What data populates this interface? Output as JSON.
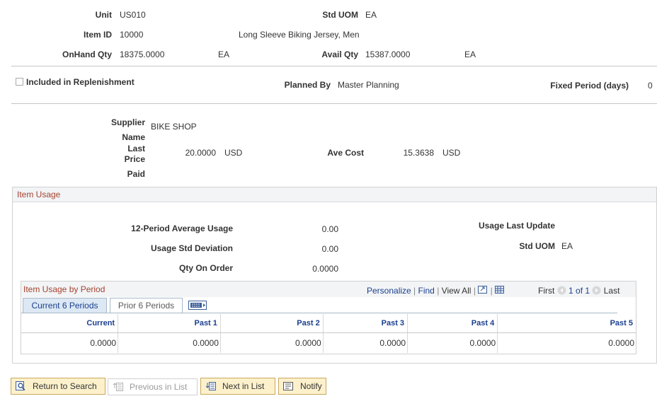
{
  "header": {
    "unit_label": "Unit",
    "unit_value": "US010",
    "std_uom_label": "Std UOM",
    "std_uom_value": "EA",
    "item_id_label": "Item ID",
    "item_id_value": "10000",
    "item_desc": "Long Sleeve Biking Jersey, Men",
    "onhand_label": "OnHand Qty",
    "onhand_value": "18375.0000",
    "onhand_uom": "EA",
    "avail_label": "Avail Qty",
    "avail_value": "15387.0000",
    "avail_uom": "EA"
  },
  "replenishment": {
    "included_label": "Included in Replenishment",
    "included_checked": false,
    "planned_by_label": "Planned By",
    "planned_by_value": "Master Planning",
    "fixed_period_label": "Fixed Period (days)",
    "fixed_period_value": "0"
  },
  "supplier": {
    "supplier_label": "Supplier",
    "name_label": "Name",
    "supplier_value": "BIKE SHOP",
    "last_label": "Last",
    "price_label": "Price",
    "paid_label": "Paid",
    "last_price_value": "20.0000",
    "last_price_currency": "USD",
    "ave_cost_label": "Ave Cost",
    "ave_cost_value": "15.3638",
    "ave_cost_currency": "USD"
  },
  "item_usage": {
    "title": "Item Usage",
    "avg_usage_label": "12-Period Average Usage",
    "avg_usage_value": "0.00",
    "std_dev_label": "Usage Std Deviation",
    "std_dev_value": "0.00",
    "qty_on_order_label": "Qty On Order",
    "qty_on_order_value": "0.0000",
    "last_update_label": "Usage Last Update",
    "std_uom_label": "Std UOM",
    "std_uom_value": "EA"
  },
  "usage_by_period": {
    "title": "Item Usage by Period",
    "personalize": "Personalize",
    "find": "Find",
    "view_all": "View All",
    "first": "First",
    "range": "1 of 1",
    "last": "Last",
    "tabs": [
      {
        "label": "Current 6 Periods",
        "active": true
      },
      {
        "label": "Prior 6 Periods",
        "active": false
      }
    ],
    "columns": [
      "Current",
      "Past 1",
      "Past 2",
      "Past 3",
      "Past 4",
      "Past 5"
    ],
    "rows": [
      [
        "0.0000",
        "0.0000",
        "0.0000",
        "0.0000",
        "0.0000",
        "0.0000"
      ]
    ]
  },
  "toolbar": {
    "return_label": "Return to Search",
    "previous_label": "Previous in List",
    "next_label": "Next in List",
    "notify_label": "Notify"
  }
}
